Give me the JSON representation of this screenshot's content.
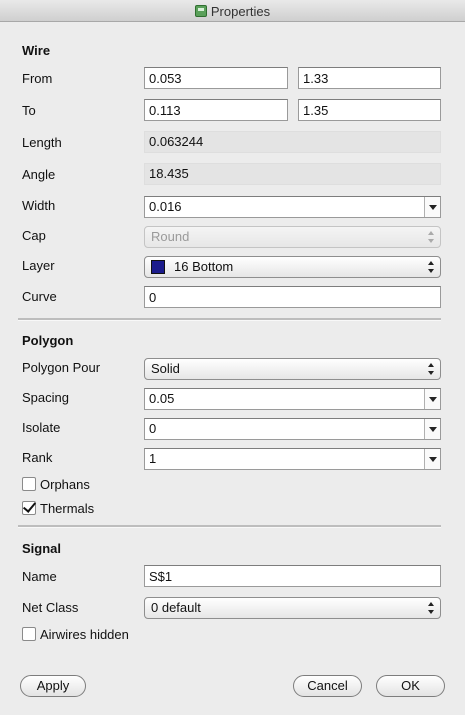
{
  "window": {
    "title": "Properties"
  },
  "wire": {
    "title": "Wire",
    "from_label": "From",
    "from_x": "0.053",
    "from_y": "1.33",
    "to_label": "To",
    "to_x": "0.113",
    "to_y": "1.35",
    "length_label": "Length",
    "length": "0.063244",
    "angle_label": "Angle",
    "angle": "18.435",
    "width_label": "Width",
    "width": "0.016",
    "cap_label": "Cap",
    "cap": "Round",
    "layer_label": "Layer",
    "layer": "16 Bottom",
    "layer_color": "#1c1c8c",
    "curve_label": "Curve",
    "curve": "0"
  },
  "polygon": {
    "title": "Polygon",
    "pour_label": "Polygon Pour",
    "pour": "Solid",
    "spacing_label": "Spacing",
    "spacing": "0.05",
    "isolate_label": "Isolate",
    "isolate": "0",
    "rank_label": "Rank",
    "rank": "1",
    "orphans_label": "Orphans",
    "orphans_checked": false,
    "thermals_label": "Thermals",
    "thermals_checked": true
  },
  "signal": {
    "title": "Signal",
    "name_label": "Name",
    "name": "S$1",
    "netclass_label": "Net Class",
    "netclass": "0 default",
    "airwires_label": "Airwires hidden",
    "airwires_checked": false
  },
  "buttons": {
    "apply": "Apply",
    "cancel": "Cancel",
    "ok": "OK"
  }
}
